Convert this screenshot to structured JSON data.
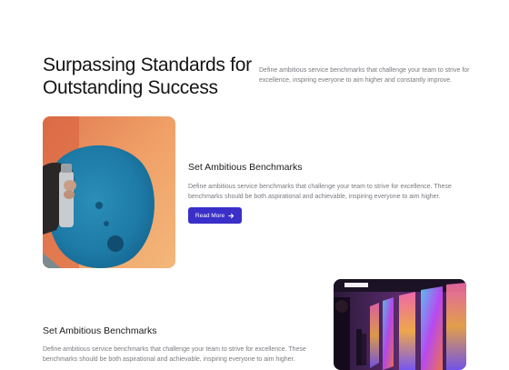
{
  "hero": {
    "title": "Surpassing Standards for Outstanding Success",
    "description": "Define ambitious service benchmarks that challenge your team to strive for excellence, inspiring everyone to aim higher and constantly improve."
  },
  "features": [
    {
      "title": "Set Ambitious Benchmarks",
      "description": "Define ambitious service benchmarks that challenge your team to strive for excellence. These benchmarks should be both aspirational and achievable, inspiring everyone to aim higher.",
      "button_label": "Read More",
      "button_icon": "arrow-right-icon",
      "image": "graffiti-mural-photo"
    },
    {
      "title": "Set Ambitious Benchmarks",
      "description": "Define ambitious service benchmarks that challenge your team to strive for excellence. These benchmarks should be both aspirational and achievable, inspiring everyone to aim higher.",
      "image": "neon-gallery-photo"
    }
  ],
  "colors": {
    "accent": "#3b2fc9",
    "text_muted": "#7a7a80",
    "text_dark": "#141416"
  }
}
